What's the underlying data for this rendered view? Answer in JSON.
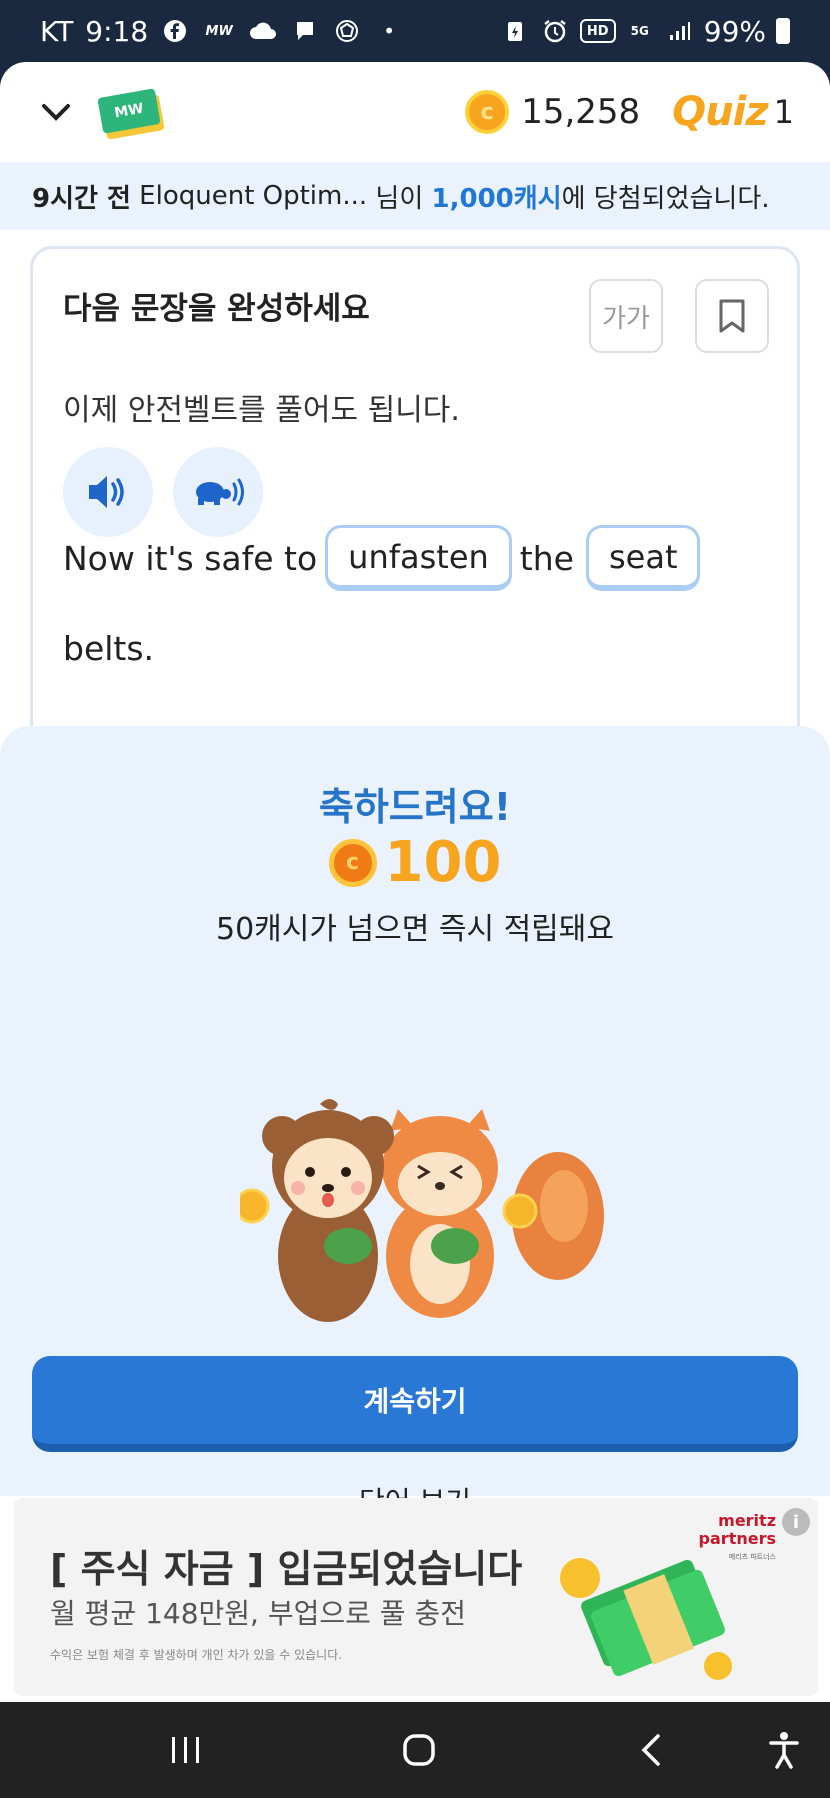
{
  "status_bar": {
    "carrier": "KT",
    "time": "9:18",
    "mw_label": "MW",
    "battery": "99%",
    "hd": "HD",
    "net": "5G"
  },
  "header": {
    "logo_text": "MW",
    "coin_symbol": "c",
    "cash_balance": "15,258",
    "quiz_logo": "Quiz",
    "quiz_count": "1"
  },
  "banner": {
    "time_ago": "9시간 전",
    "user": "Eloquent Optim...",
    "middle": "님이",
    "prize": "1,000캐시",
    "suffix": "에 당첨되었습니다."
  },
  "quiz": {
    "instruction": "다음 문장을 완성하세요",
    "font_size_label": "가가",
    "korean_sentence": "이제 안전벨트를 풀어도 됩니다.",
    "english_words": [
      "Now it's safe to",
      "unfasten",
      "the",
      "seat",
      "belts."
    ]
  },
  "result": {
    "title": "축하드려요!",
    "coin_symbol": "c",
    "reward_amount": "100",
    "note": "50캐시가 넘으면 즉시 적립돼요",
    "continue_label": "계속하기",
    "view_words_label": "단어 보기"
  },
  "ad": {
    "title": "[ 주식 자금 ] 입금되었습니다",
    "subtitle": "월 평균 148만원, 부업으로 풀 충전",
    "disclaimer": "수익은 보험 체결 후 발생하며 개인 차가 있을 수 있습니다.",
    "brand": "meritz",
    "brand2": "partners",
    "brand_small": "메리츠 파트너스",
    "info": "i"
  },
  "colors": {
    "accent_blue": "#2a78d6",
    "coin_orange": "#f7a51f",
    "sheet_bg": "#eaf2fd",
    "congrats_blue": "#2674c8"
  }
}
